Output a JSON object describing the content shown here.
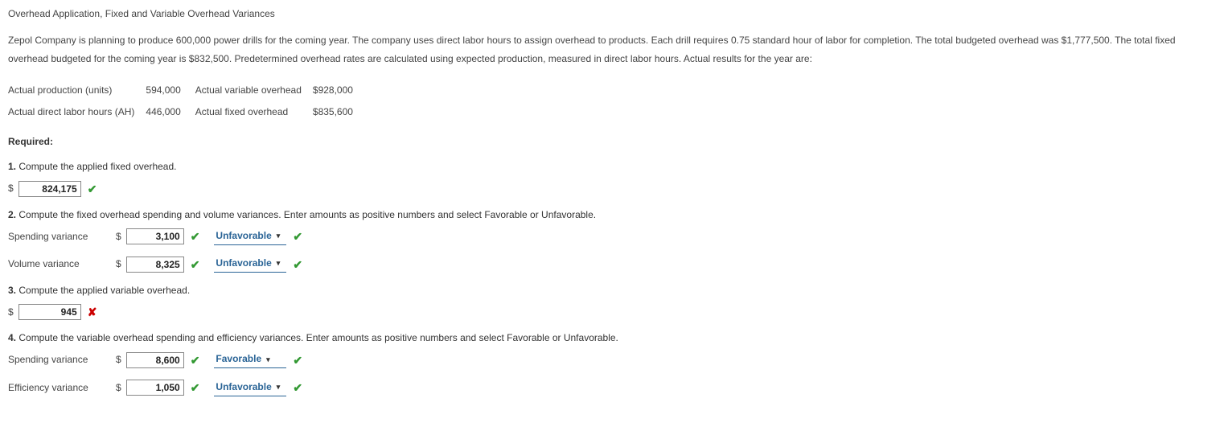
{
  "title": "Overhead Application, Fixed and Variable Overhead Variances",
  "intro": "Zepol Company is planning to produce 600,000 power drills for the coming year. The company uses direct labor hours to assign overhead to products. Each drill requires 0.75 standard hour of labor for completion. The total budgeted overhead was $1,777,500. The total fixed overhead budgeted for the coming year is $832,500. Predetermined overhead rates are calculated using expected production, measured in direct labor hours. Actual results for the year are:",
  "actuals": {
    "r1c1_label": "Actual production (units)",
    "r1c1_val": "594,000",
    "r1c2_label": "Actual variable overhead",
    "r1c2_val": "$928,000",
    "r2c1_label": "Actual direct labor hours (AH)",
    "r2c1_val": "446,000",
    "r2c2_label": "Actual fixed overhead",
    "r2c2_val": "$835,600"
  },
  "required_label": "Required:",
  "q1": {
    "num": "1.",
    "text": " Compute the applied fixed overhead.",
    "value": "824,175"
  },
  "q2": {
    "num": "2.",
    "text": " Compute the fixed overhead spending and volume variances. Enter amounts as positive numbers and select Favorable or Unfavorable.",
    "spending_label": "Spending variance",
    "spending_value": "3,100",
    "spending_select": "Unfavorable",
    "volume_label": "Volume variance",
    "volume_value": "8,325",
    "volume_select": "Unfavorable"
  },
  "q3": {
    "num": "3.",
    "text": " Compute the applied variable overhead.",
    "value": "945"
  },
  "q4": {
    "num": "4.",
    "text": " Compute the variable overhead spending and efficiency variances. Enter amounts as positive numbers and select Favorable or Unfavorable.",
    "spending_label": "Spending variance",
    "spending_value": "8,600",
    "spending_select": "Favorable",
    "efficiency_label": "Efficiency variance",
    "efficiency_value": "1,050",
    "efficiency_select": "Unfavorable"
  },
  "glyph": {
    "check": "✔",
    "cross": "✘",
    "caret": "▾",
    "dollar": "$"
  }
}
